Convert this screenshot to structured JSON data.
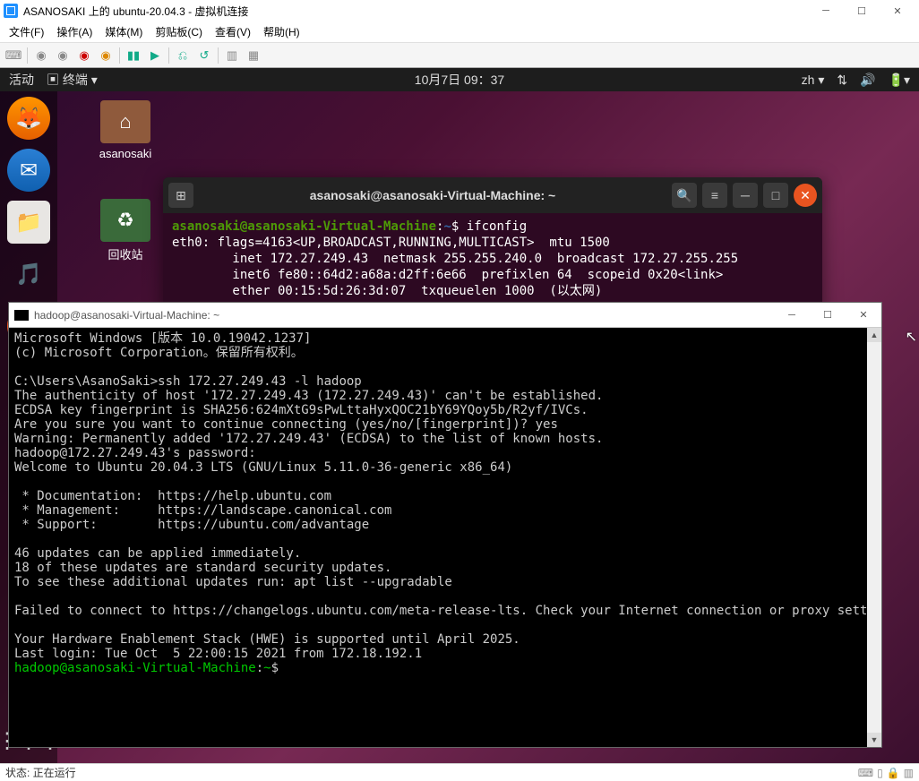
{
  "vm": {
    "title": "ASANOSAKI 上的 ubuntu-20.04.3 - 虚拟机连接",
    "menubar": [
      "文件(F)",
      "操作(A)",
      "媒体(M)",
      "剪贴板(C)",
      "查看(V)",
      "帮助(H)"
    ],
    "status": "状态: 正在运行"
  },
  "ubuntu_top": {
    "activities": "活动",
    "app": "终端",
    "clock": "10月7日  09：37",
    "lang": "zh"
  },
  "desktop_icons": {
    "home": "asanosaki",
    "trash": "回收站"
  },
  "gnome_terminal": {
    "title": "asanosaki@asanosaki-Virtual-Machine: ~",
    "prompt_user": "asanosaki@asanosaki-Virtual-Machine",
    "prompt_path": "~",
    "cmd": "ifconfig",
    "output": "eth0: flags=4163<UP,BROADCAST,RUNNING,MULTICAST>  mtu 1500\n        inet 172.27.249.43  netmask 255.255.240.0  broadcast 172.27.255.255\n        inet6 fe80::64d2:a68a:d2ff:6e66  prefixlen 64  scopeid 0x20<link>\n        ether 00:15:5d:26:3d:07  txqueuelen 1000  (以太网)"
  },
  "win_terminal": {
    "title": "hadoop@asanosaki-Virtual-Machine: ~",
    "header": "Microsoft Windows [版本 10.0.19042.1237]\n(c) Microsoft Corporation。保留所有权利。",
    "blank": "",
    "cmd_prompt": "C:\\Users\\AsanoSaki>",
    "cmd": "ssh 172.27.249.43 -l hadoop",
    "auth": "The authenticity of host '172.27.249.43 (172.27.249.43)' can't be established.\nECDSA key fingerprint is SHA256:624mXtG9sPwLttaHyxQOC21bY69YQoy5b/R2yf/IVCs.\nAre you sure you want to continue connecting (yes/no/[fingerprint])? yes\nWarning: Permanently added '172.27.249.43' (ECDSA) to the list of known hosts.\nhadoop@172.27.249.43's password:\nWelcome to Ubuntu 20.04.3 LTS (GNU/Linux 5.11.0-36-generic x86_64)",
    "info": " * Documentation:  https://help.ubuntu.com\n * Management:     https://landscape.canonical.com\n * Support:        https://ubuntu.com/advantage",
    "updates": "46 updates can be applied immediately.\n18 of these updates are standard security updates.\nTo see these additional updates run: apt list --upgradable",
    "fail": "Failed to connect to https://changelogs.ubuntu.com/meta-release-lts. Check your Internet connection or proxy settings",
    "hwe": "Your Hardware Enablement Stack (HWE) is supported until April 2025.\nLast login: Tue Oct  5 22:00:15 2021 from 172.18.192.1",
    "ssh_prompt_user": "hadoop@asanosaki-Virtual-Machine",
    "ssh_prompt_path": "~",
    "ssh_prompt_suffix": "$ "
  }
}
